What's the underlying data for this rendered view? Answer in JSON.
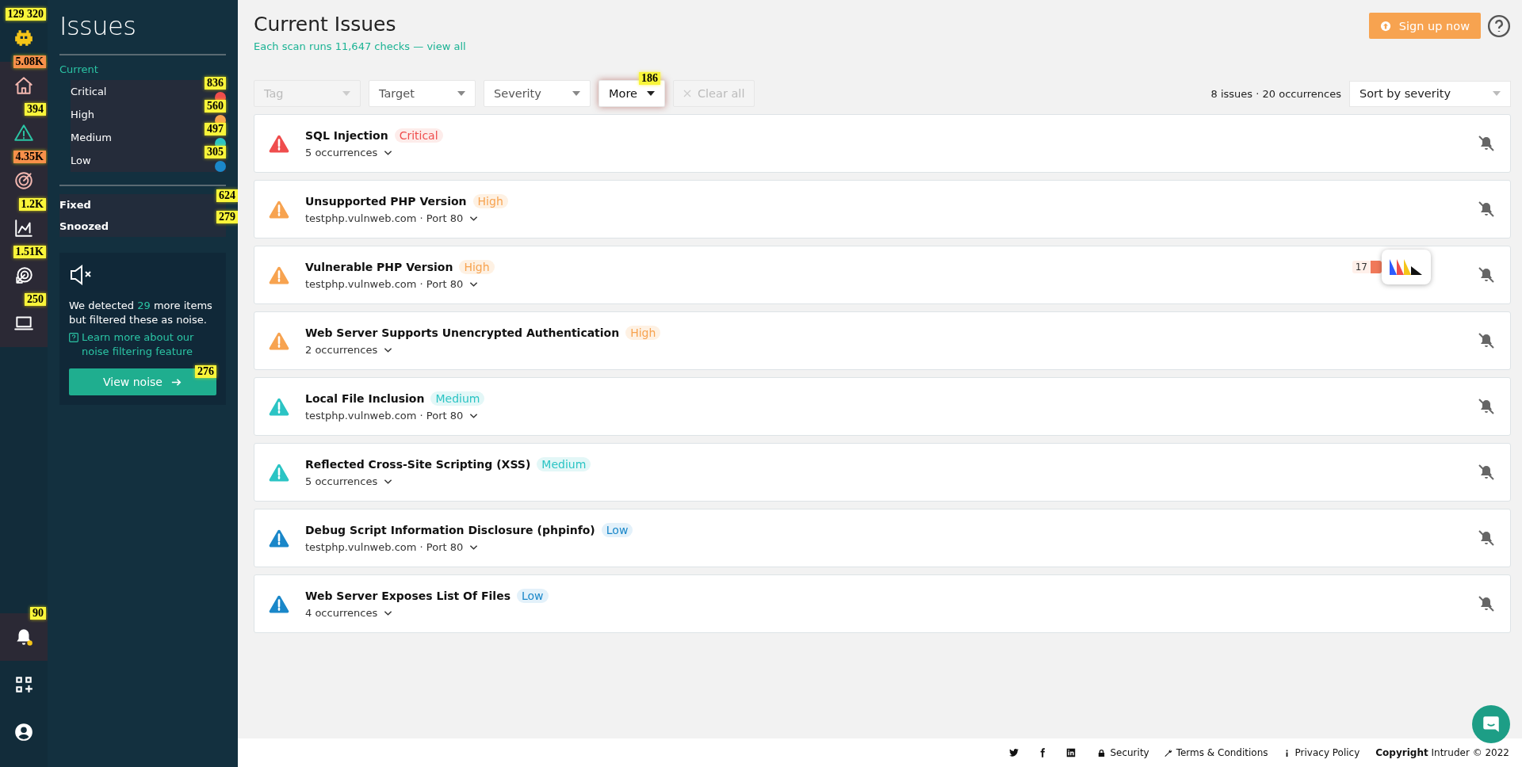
{
  "rail": {
    "logo_heat": "129 320",
    "items": [
      {
        "kind": "home",
        "selected": false,
        "heat": {
          "count": "5.08K",
          "color": "#f7904a"
        }
      },
      {
        "kind": "warning",
        "selected": true,
        "heat": {
          "count": "394",
          "color": "#f9f53a"
        }
      },
      {
        "kind": "target",
        "selected": false,
        "heat": {
          "count": "4.35K",
          "color": "#f7904a"
        }
      },
      {
        "kind": "chart",
        "selected": false,
        "heat": {
          "count": "1.2K",
          "color": "#f9f53a"
        }
      },
      {
        "kind": "radar",
        "selected": false,
        "heat": {
          "count": "1.51K",
          "color": "#f9f53a"
        }
      },
      {
        "kind": "laptop",
        "selected": false,
        "heat": {
          "count": "250",
          "color": "#f9f53a"
        }
      }
    ],
    "bottom": [
      {
        "kind": "bell",
        "selected": false,
        "heat": {
          "count": "90",
          "color": "#f9f53a"
        }
      },
      {
        "kind": "apps",
        "selected": false
      },
      {
        "kind": "user",
        "selected": false
      }
    ]
  },
  "sidebar": {
    "title": "Issues",
    "section": "Current",
    "levels": [
      {
        "label": "Critical",
        "kind": "critical",
        "heat": "836"
      },
      {
        "label": "High",
        "kind": "high",
        "heat": "560"
      },
      {
        "label": "Medium",
        "kind": "medium",
        "heat": "497"
      },
      {
        "label": "Low",
        "kind": "low",
        "heat": "305"
      }
    ],
    "other": [
      {
        "label": "Fixed",
        "heat": "624"
      },
      {
        "label": "Snoozed",
        "heat": "279"
      }
    ],
    "noise": {
      "text_before": "We detected",
      "count": "29",
      "text_after": "more items but filtered these as noise.",
      "link": "Learn more about our noise filtering feature",
      "button": "View noise",
      "button_heat": "276"
    }
  },
  "header": {
    "title": "Current Issues",
    "subtitle": "Each scan runs 11,647 checks — view all",
    "signup": "Sign up now"
  },
  "filters": [
    {
      "label": "Tag",
      "kind": "select",
      "disabled": true
    },
    {
      "label": "Target",
      "kind": "select",
      "disabled": false
    },
    {
      "label": "Severity",
      "kind": "select",
      "disabled": false
    },
    {
      "label": "More",
      "kind": "more",
      "disabled": false,
      "heat": "186"
    },
    {
      "label": "Clear all",
      "kind": "clear",
      "disabled": true
    }
  ],
  "summary": "8 issues · 20 occurrences",
  "sort": "Sort by severity",
  "issues": [
    {
      "title": "SQL Injection",
      "severity": "Critical",
      "kind": "critical",
      "detail": "5 occurrences"
    },
    {
      "title": "Unsupported PHP Version",
      "severity": "High",
      "kind": "high",
      "detail": "testphp.vulnweb.com · Port 80"
    },
    {
      "title": "Vulnerable PHP Version",
      "severity": "High",
      "kind": "high",
      "detail": "testphp.vulnweb.com · Port 80",
      "overlay_count": "17"
    },
    {
      "title": "Web Server Supports Unencrypted Authentication",
      "severity": "High",
      "kind": "high",
      "detail": "2 occurrences"
    },
    {
      "title": "Local File Inclusion",
      "severity": "Medium",
      "kind": "medium",
      "detail": "testphp.vulnweb.com · Port 80"
    },
    {
      "title": "Reflected Cross-Site Scripting (XSS)",
      "severity": "Medium",
      "kind": "medium",
      "detail": "5 occurrences"
    },
    {
      "title": "Debug Script Information Disclosure (phpinfo)",
      "severity": "Low",
      "kind": "low",
      "detail": "testphp.vulnweb.com · Port 80"
    },
    {
      "title": "Web Server Exposes List Of Files",
      "severity": "Low",
      "kind": "low",
      "detail": "4 occurrences"
    }
  ],
  "footer": {
    "links": [
      "Security",
      "Terms & Conditions",
      "Privacy Policy"
    ],
    "copyright": "**Copyright** Intruder © 2022"
  }
}
